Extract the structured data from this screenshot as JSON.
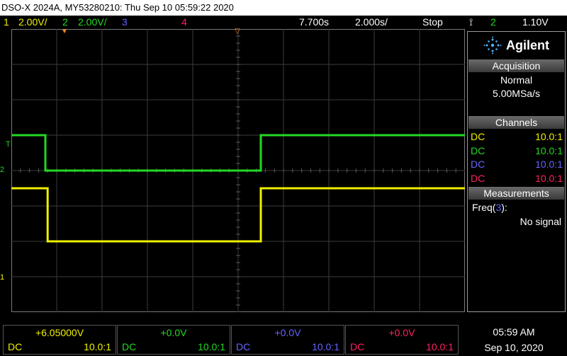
{
  "title": "DSO-X 2024A, MY53280210: Thu Sep 10 05:59:22 2020",
  "status": {
    "ch1_num": "1",
    "ch1_scale": "2.00V/",
    "ch2_num": "2",
    "ch2_scale": "2.00V/",
    "ch3_num": "3",
    "ch4_num": "4",
    "delay": "7.700s",
    "timebase": "2.000s/",
    "run_state": "Stop",
    "trig_icon": "trigger-edge-icon",
    "trig_src": "2",
    "trig_level": "1.10V"
  },
  "panel": {
    "brand": "Agilent",
    "acq_head": "Acquisition",
    "acq_mode": "Normal",
    "acq_rate": "5.00MSa/s",
    "ch_head": "Channels",
    "channels": [
      {
        "coupling": "DC",
        "probe": "10.0:1",
        "color": "#f0f000"
      },
      {
        "coupling": "DC",
        "probe": "10.0:1",
        "color": "#22d822"
      },
      {
        "coupling": "DC",
        "probe": "10.0:1",
        "color": "#6464ff"
      },
      {
        "coupling": "DC",
        "probe": "10.0:1",
        "color": "#ff2060"
      }
    ],
    "meas_head": "Measurements",
    "meas_label": "Freq(",
    "meas_src": "3",
    "meas_close": "):",
    "meas_value": "No signal"
  },
  "markers": {
    "trig_T": "T",
    "ch2_marker": "2",
    "ch1_marker": "1"
  },
  "bottom": [
    {
      "value": "+6.05000V",
      "coupling": "DC",
      "probe": "10.0:1",
      "color": "#f0f000"
    },
    {
      "value": "+0.0V",
      "coupling": "DC",
      "probe": "10.0:1",
      "color": "#22d822"
    },
    {
      "value": "+0.0V",
      "coupling": "DC",
      "probe": "10.0:1",
      "color": "#6464ff"
    },
    {
      "value": "+0.0V",
      "coupling": "DC",
      "probe": "10.0:1",
      "color": "#ff2060"
    }
  ],
  "clock": {
    "time": "05:59 AM",
    "date": "Sep 10, 2020"
  },
  "traces": {
    "ch2": {
      "high_div": 5.0,
      "low_div": 4.0,
      "fall_div": 0.75,
      "rise_div": 5.5,
      "color": "#22d822"
    },
    "ch1": {
      "high_div": 3.5,
      "low_div": 2.0,
      "fall_div": 0.8,
      "rise_div": 5.5,
      "color": "#f0f000"
    }
  }
}
